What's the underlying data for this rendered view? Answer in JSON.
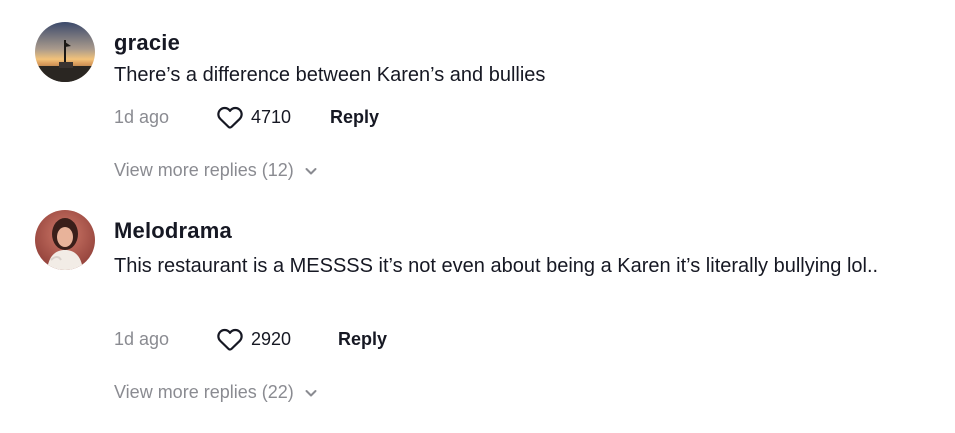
{
  "comments": [
    {
      "username": "gracie",
      "text": "There’s a difference between Karen’s and bullies",
      "time": "1d ago",
      "likes": "4710",
      "reply_label": "Reply",
      "view_more": "View more replies (12)",
      "avatar_icon": "sunset-photo-avatar"
    },
    {
      "username": "Melodrama",
      "text": "This restaurant is a MESSSS it’s not even about being a Karen it’s literally bullying lol..",
      "time": "1d ago",
      "likes": "2920",
      "reply_label": "Reply",
      "view_more": "View more replies (22)",
      "avatar_icon": "portrait-photo-avatar"
    }
  ],
  "colors": {
    "text_primary": "#161823",
    "text_secondary": "#8a8b91",
    "background": "#ffffff"
  }
}
